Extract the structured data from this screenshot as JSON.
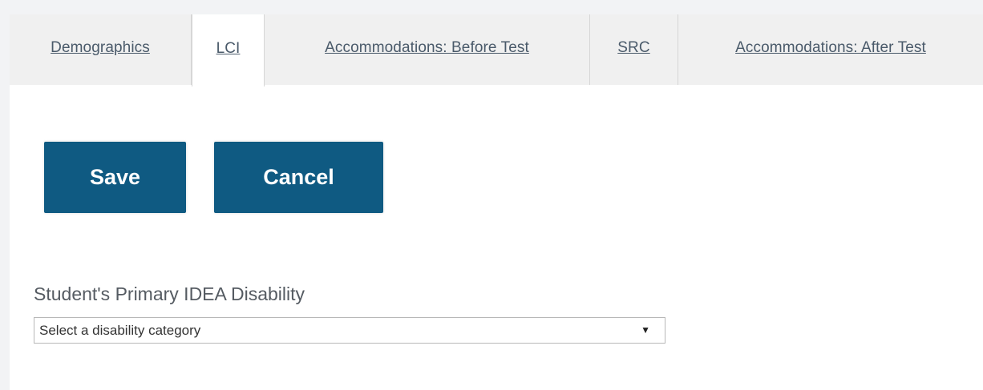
{
  "tabs": [
    {
      "label": "Demographics"
    },
    {
      "label": "LCI"
    },
    {
      "label": "Accommodations: Before Test"
    },
    {
      "label": "SRC"
    },
    {
      "label": "Accommodations: After Test"
    }
  ],
  "active_tab": "LCI",
  "buttons": {
    "save_label": "Save",
    "cancel_label": "Cancel"
  },
  "disability_field": {
    "label": "Student's Primary IDEA Disability",
    "selected_value": "Select a disability category"
  },
  "colors": {
    "button_bg": "#0f5a82",
    "tab_bg": "#f0f0f0",
    "tab_text": "#4a5a6a"
  },
  "icons": {
    "dropdown": "triangle-down-icon"
  }
}
